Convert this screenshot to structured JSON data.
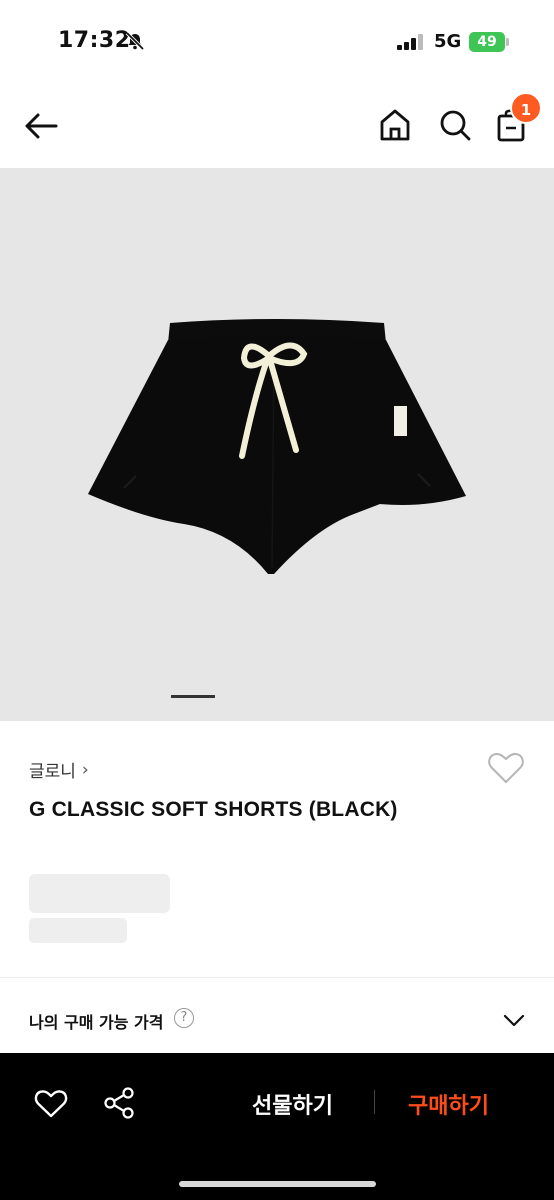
{
  "status_bar": {
    "time": "17:32",
    "network": "5G",
    "battery": "49"
  },
  "header": {
    "cart_count": "1",
    "icons": [
      "back-arrow-icon",
      "home-icon",
      "search-icon",
      "shopping-bag-icon"
    ],
    "badge_color": "#ff5a1f"
  },
  "product": {
    "image": "black-shorts",
    "image_count_shown": 1,
    "brand": "글로니",
    "brand_chevron": "›",
    "name": "G CLASSIC SOFT SHORTS (BLACK)"
  },
  "price_section": {
    "label": "나의 구매 가능 가격",
    "help": "?"
  },
  "bottom_bar": {
    "gift_label": "선물하기",
    "buy_label": "구매하기",
    "buy_color": "#ff4d1a"
  }
}
